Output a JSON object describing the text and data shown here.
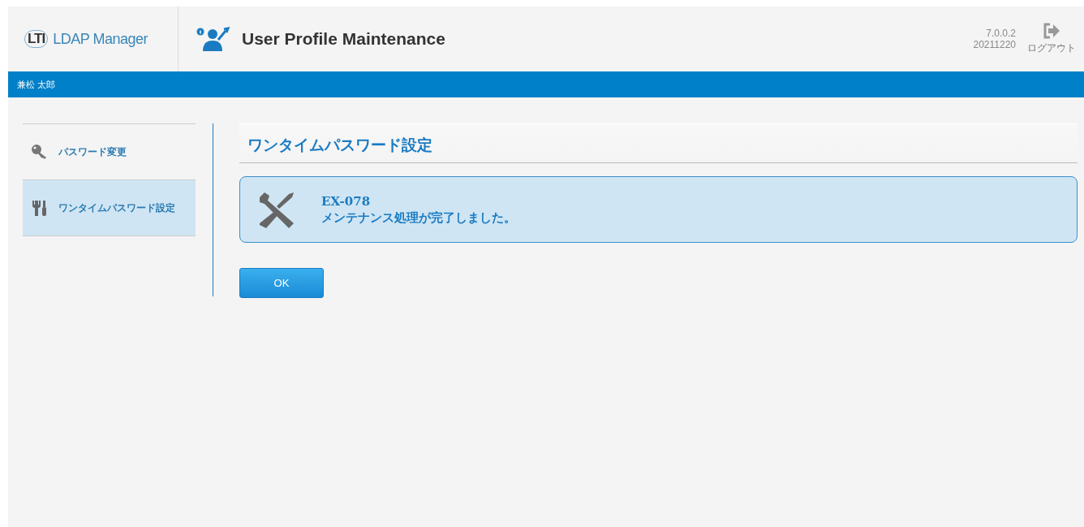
{
  "header": {
    "logo_mark": "LTI",
    "app_name": "LDAP Manager",
    "title": "User Profile Maintenance",
    "version": "7.0.0.2",
    "build": "20211220",
    "logout_label": "ログアウト"
  },
  "user_bar": {
    "user_name": "兼松 太郎"
  },
  "sidebar": {
    "items": [
      {
        "label": "パスワード変更",
        "kind": "key",
        "selected": false
      },
      {
        "label": "ワンタイムパスワード設定",
        "kind": "tools",
        "selected": true
      }
    ]
  },
  "main": {
    "heading": "ワンタイムパスワード設定",
    "message": {
      "code": "EX-078",
      "text": "メンテナンス処理が完了しました。"
    },
    "buttons": [
      "OK"
    ]
  }
}
